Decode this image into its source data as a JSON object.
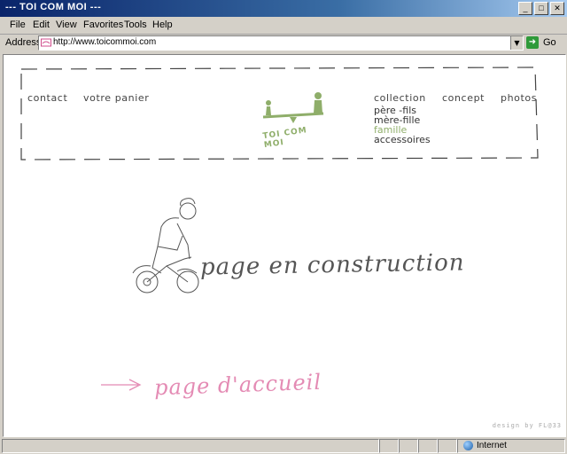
{
  "window": {
    "title": "--- TOI COM MOI ---"
  },
  "menu": [
    {
      "label": "File"
    },
    {
      "label": "Edit"
    },
    {
      "label": "View"
    },
    {
      "label": "Favorites"
    },
    {
      "label": "Tools"
    },
    {
      "label": "Help"
    }
  ],
  "address": {
    "label": "Address",
    "url": "http://www.toicommoi.com",
    "go_label": "Go"
  },
  "nav": {
    "left": [
      {
        "label": "contact"
      },
      {
        "label": "votre panier"
      }
    ],
    "logo_text": "TOI COM MOI",
    "right": [
      {
        "label": "collection"
      },
      {
        "label": "concept"
      },
      {
        "label": "photos"
      }
    ],
    "collection_items": [
      {
        "label": "père -fils"
      },
      {
        "label": "mère-fille"
      },
      {
        "label": "famille",
        "active": true
      },
      {
        "label": "accessoires"
      }
    ]
  },
  "content": {
    "construction_text": "page en construction",
    "home_link_text": "page d'accueil",
    "credit": "design by FL@33"
  },
  "status": {
    "zone": "Internet"
  },
  "colors": {
    "accent_green": "#8fae6a",
    "link_pink": "#e48bb4",
    "title_blue": "#0a246a"
  }
}
